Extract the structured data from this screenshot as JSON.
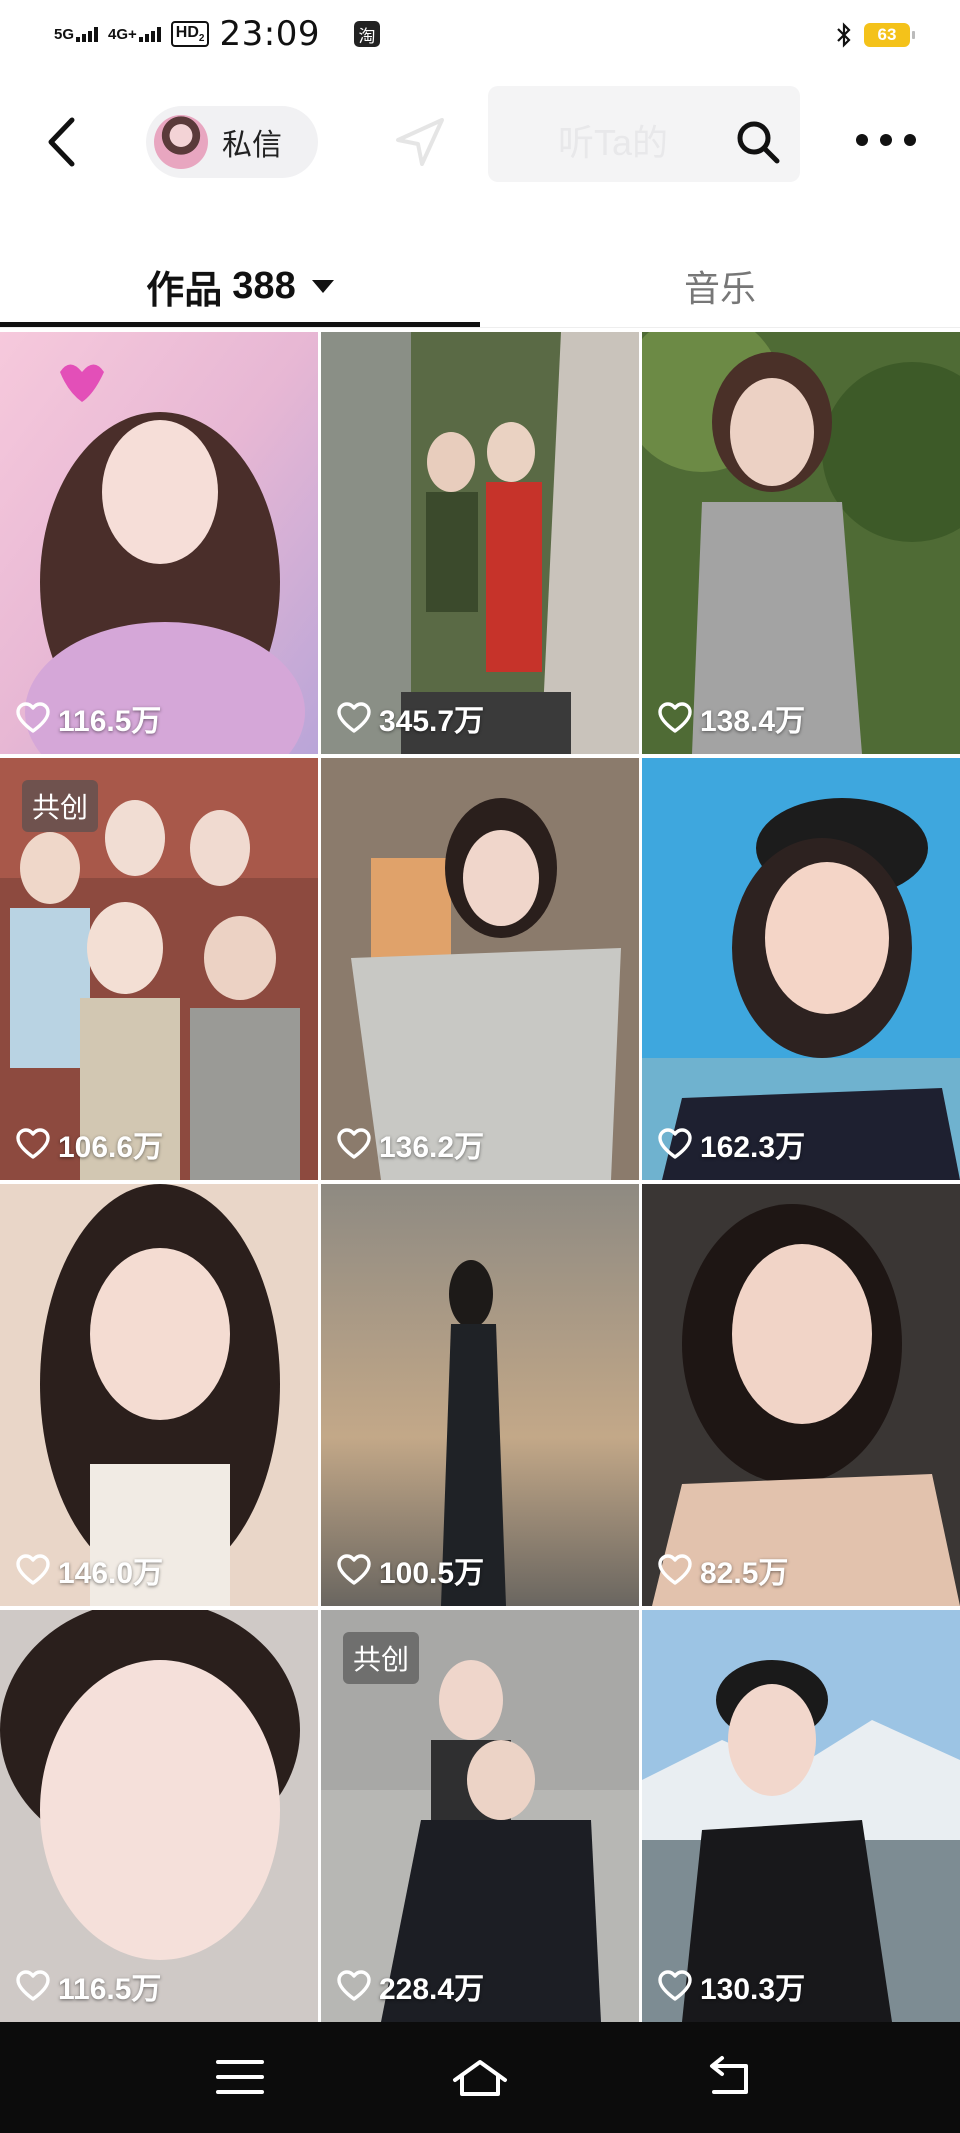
{
  "status_bar": {
    "signal_1": "5G",
    "signal_2": "4G+",
    "hd_badge": "HD",
    "hd_sub": "2",
    "time": "23:09",
    "app_badge": "淘",
    "battery": "63"
  },
  "top_nav": {
    "dm_label": "私信",
    "search_ghost_text": "听Ta的"
  },
  "tabs": {
    "works_label": "作品",
    "works_count": "388",
    "music_label": "音乐"
  },
  "grid": {
    "tiles": [
      {
        "likes": "116.5万",
        "tag": ""
      },
      {
        "likes": "345.7万",
        "tag": ""
      },
      {
        "likes": "138.4万",
        "tag": ""
      },
      {
        "likes": "106.6万",
        "tag": "共创"
      },
      {
        "likes": "136.2万",
        "tag": ""
      },
      {
        "likes": "162.3万",
        "tag": ""
      },
      {
        "likes": "146.0万",
        "tag": ""
      },
      {
        "likes": "100.5万",
        "tag": ""
      },
      {
        "likes": "82.5万",
        "tag": ""
      },
      {
        "likes": "116.5万",
        "tag": ""
      },
      {
        "likes": "228.4万",
        "tag": "共创"
      },
      {
        "likes": "130.3万",
        "tag": ""
      }
    ]
  },
  "icons": {
    "back": "chevron-left-icon",
    "search": "search-icon",
    "more": "more-horizontal-icon",
    "heart": "heart-outline-icon",
    "menu": "menu-icon",
    "home": "home-icon",
    "return": "return-icon"
  },
  "colors": {
    "battery": "#f4c21a",
    "nav_bar": "#0c0c0c",
    "tab_active": "#111111",
    "tab_inactive": "#777777"
  }
}
